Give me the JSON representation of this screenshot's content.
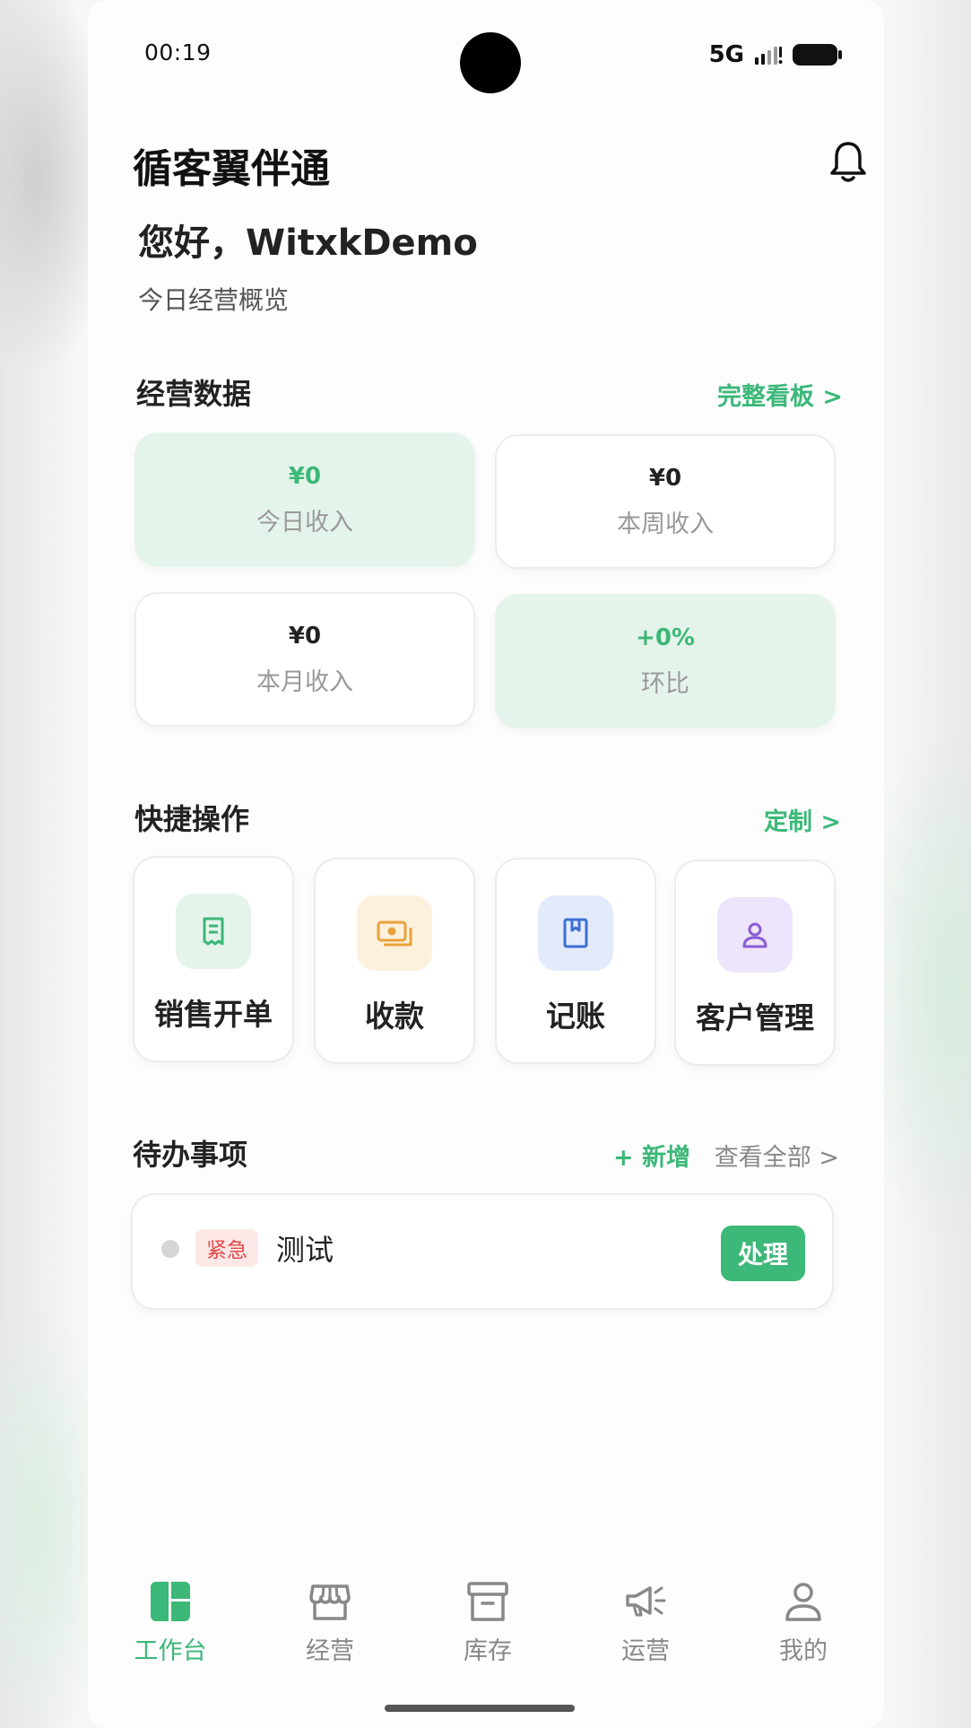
{
  "status": {
    "time": "00:19",
    "network": "5G"
  },
  "header": {
    "title": "循客翼伴通",
    "greeting": "您好，WitxkDemo",
    "subtitle": "今日经营概览"
  },
  "business": {
    "title": "经营数据",
    "link": "完整看板 >",
    "stats": [
      {
        "value": "¥0",
        "label": "今日收入"
      },
      {
        "value": "¥0",
        "label": "本周收入"
      },
      {
        "value": "¥0",
        "label": "本月收入"
      },
      {
        "value": "+0%",
        "label": "环比"
      }
    ]
  },
  "quick": {
    "title": "快捷操作",
    "link": "定制 >",
    "actions": [
      {
        "label": "销售开单",
        "icon": "receipt-icon",
        "color": "#3cb878"
      },
      {
        "label": "收款",
        "icon": "cash-icon",
        "color": "#e9a23b"
      },
      {
        "label": "记账",
        "icon": "book-icon",
        "color": "#3d6fd6"
      },
      {
        "label": "客户管理",
        "icon": "user-icon",
        "color": "#8a5cd6"
      }
    ]
  },
  "todo": {
    "title": "待办事项",
    "add": "+ 新增",
    "view_all": "查看全部 >",
    "items": [
      {
        "badge": "紧急",
        "text": "测试",
        "action": "处理"
      }
    ]
  },
  "nav": {
    "items": [
      {
        "label": "工作台",
        "icon": "dashboard-icon",
        "active": true
      },
      {
        "label": "经营",
        "icon": "store-icon"
      },
      {
        "label": "库存",
        "icon": "archive-icon"
      },
      {
        "label": "运营",
        "icon": "megaphone-icon"
      },
      {
        "label": "我的",
        "icon": "person-icon"
      }
    ]
  },
  "colors": {
    "accent": "#3cb878",
    "accent_bg": "#e5f4ea",
    "urgent": "#e24b4b"
  }
}
